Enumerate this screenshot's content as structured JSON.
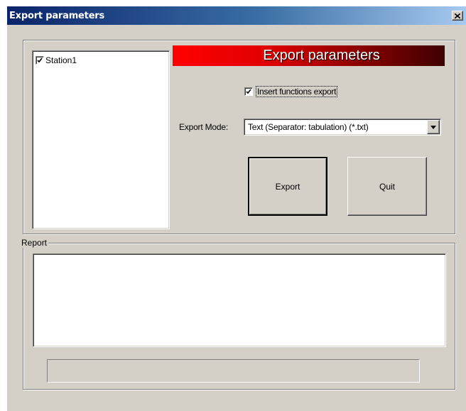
{
  "window": {
    "title": "Export parameters",
    "close_icon": "close-x-icon"
  },
  "stations": [
    {
      "label": "Station1",
      "checked": true
    }
  ],
  "banner": {
    "text": "Export parameters",
    "gradient_colors": [
      "#ff0000",
      "#400000"
    ]
  },
  "options": {
    "insert_functions_label": "Insert functions export",
    "insert_functions_checked": true,
    "export_mode_label": "Export Mode:",
    "export_mode_value": "Text (Separator: tabulation) (*.txt)"
  },
  "buttons": {
    "export_label": "Export",
    "quit_label": "Quit"
  },
  "report": {
    "legend": "Report",
    "content": "",
    "progress_percent": 0
  },
  "colors": {
    "face": "#d4d0c8",
    "titlebar_start": "#0a246a",
    "titlebar_end": "#a6caf0"
  }
}
